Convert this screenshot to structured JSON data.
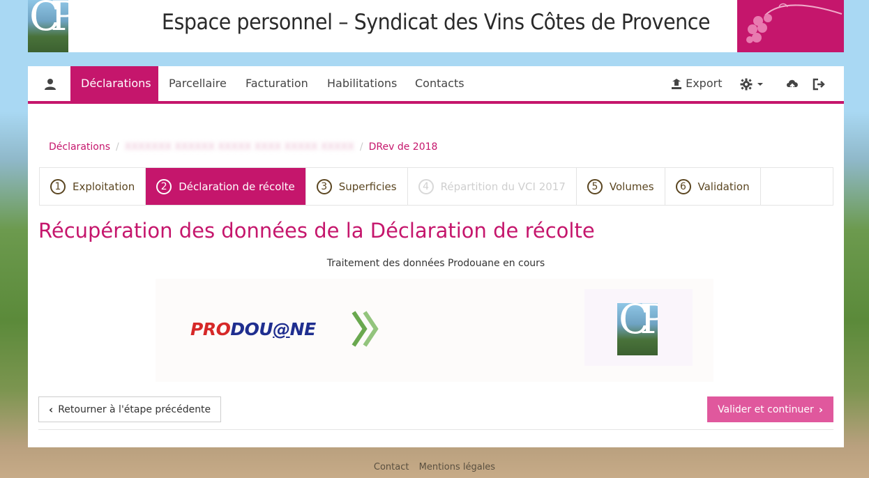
{
  "header": {
    "title": "Espace personnel – Syndicat des Vins Côtes de Provence",
    "logo_text": "CP"
  },
  "nav": {
    "items": [
      "Déclarations",
      "Parcellaire",
      "Facturation",
      "Habilitations",
      "Contacts"
    ],
    "export_label": "Export",
    "active": "Déclarations"
  },
  "breadcrumb": {
    "home": "Déclarations",
    "blurred": "XXXXXXX XXXXXX XXXXX XXXX XXXXX XXXXX",
    "current": "DRev de 2018"
  },
  "steps": [
    {
      "num": "1",
      "label": "Exploitation",
      "state": "done"
    },
    {
      "num": "2",
      "label": "Déclaration de récolte",
      "state": "active"
    },
    {
      "num": "3",
      "label": "Superficies",
      "state": "todo"
    },
    {
      "num": "4",
      "label": "Répartition du VCI 2017",
      "state": "disabled"
    },
    {
      "num": "5",
      "label": "Volumes",
      "state": "todo"
    },
    {
      "num": "6",
      "label": "Validation",
      "state": "todo"
    }
  ],
  "main": {
    "title": "Récupération des données de la Déclaration de récolte",
    "status": "Traitement des données Prodouane en cours",
    "prodouane_logo": {
      "part1": "PRO",
      "part2": "DOU",
      "part3": "@",
      "part4": "NE"
    }
  },
  "actions": {
    "back_label": "Retourner à l'étape précédente",
    "next_label": "Valider et continuer"
  },
  "footer": {
    "contact": "Contact",
    "legal": "Mentions légales"
  },
  "colors": {
    "brand": "#c5166c",
    "next_button": "#e0589d",
    "step_text": "#5a4520"
  }
}
